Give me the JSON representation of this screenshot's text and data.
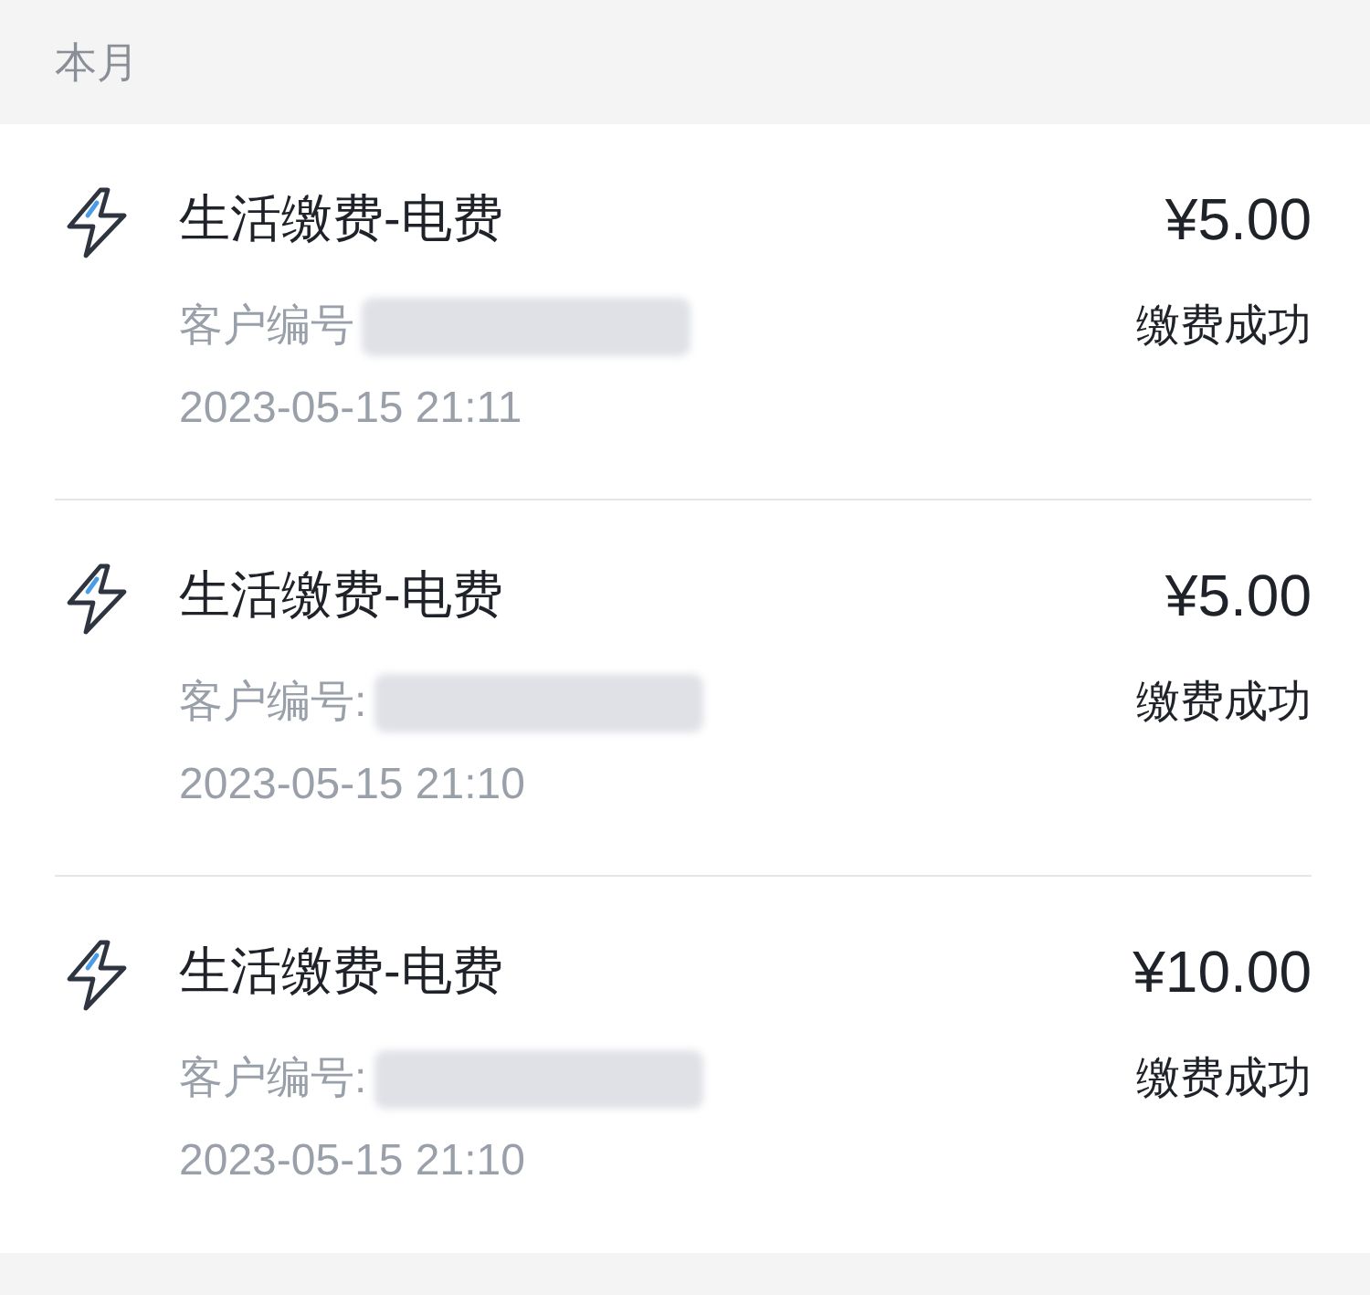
{
  "section_header": "本月",
  "records": [
    {
      "title": "生活缴费-电费",
      "amount": "¥5.00",
      "customer_label": "客户编号",
      "status": "缴费成功",
      "time": "2023-05-15 21:11"
    },
    {
      "title": "生活缴费-电费",
      "amount": "¥5.00",
      "customer_label": "客户编号:",
      "status": "缴费成功",
      "time": "2023-05-15 21:10"
    },
    {
      "title": "生活缴费-电费",
      "amount": "¥10.00",
      "customer_label": "客户编号:",
      "status": "缴费成功",
      "time": "2023-05-15 21:10"
    }
  ]
}
